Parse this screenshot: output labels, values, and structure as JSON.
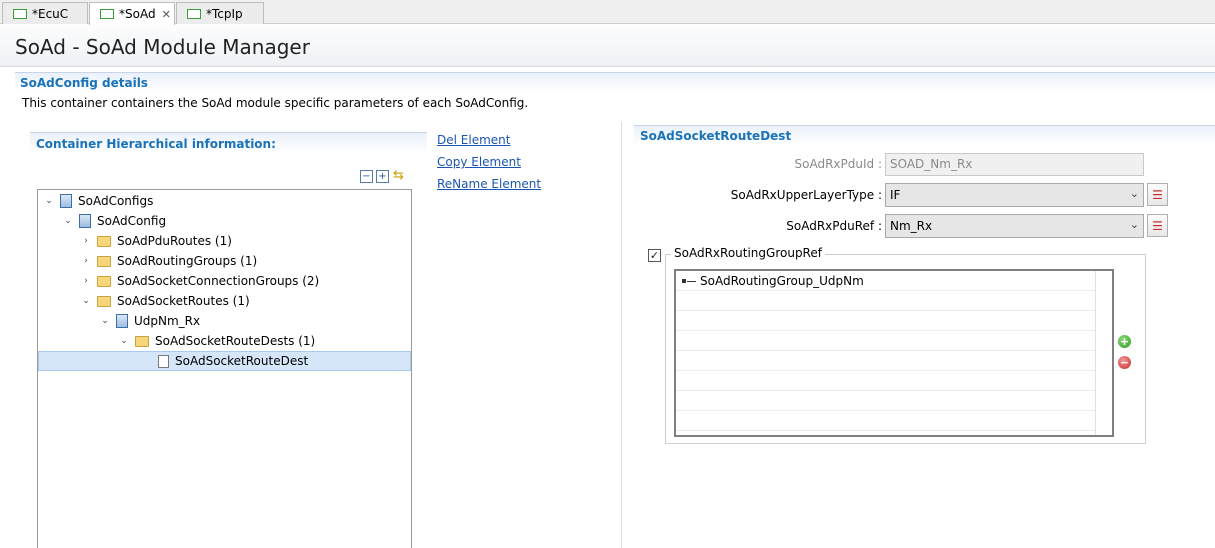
{
  "tabs": [
    {
      "label": "*EcuC"
    },
    {
      "label": "*SoAd",
      "close": "✕"
    },
    {
      "label": "*TcpIp"
    }
  ],
  "page_title": "SoAd - SoAd Module Manager",
  "section": {
    "title": "SoAdConfig details",
    "description": "This container containers the SoAd module specific parameters of each SoAdConfig."
  },
  "hierarchy": {
    "title": "Container Hierarchical information:",
    "tools": {
      "collapse": "−",
      "expand": "+",
      "sync": "⇆"
    },
    "nodes": [
      {
        "label": "SoAdConfigs",
        "twisty": "⌄"
      },
      {
        "label": "SoAdConfig",
        "twisty": "⌄"
      },
      {
        "label": "SoAdPduRoutes (1)",
        "twisty": "›"
      },
      {
        "label": "SoAdRoutingGroups (1)",
        "twisty": "›"
      },
      {
        "label": "SoAdSocketConnectionGroups (2)",
        "twisty": "›"
      },
      {
        "label": "SoAdSocketRoutes (1)",
        "twisty": "⌄"
      },
      {
        "label": "UdpNm_Rx",
        "twisty": "⌄"
      },
      {
        "label": "SoAdSocketRouteDests (1)",
        "twisty": "⌄"
      },
      {
        "label": "SoAdSocketRouteDest",
        "twisty": ""
      }
    ]
  },
  "actions": {
    "delete": "Del Element",
    "copy": "Copy Element",
    "rename": "ReName Element"
  },
  "details": {
    "title": "SoAdSocketRouteDest",
    "fields": {
      "rx_pdu_id": {
        "label": "SoAdRxPduId :",
        "value": "SOAD_Nm_Rx"
      },
      "upper_layer_type": {
        "label": "SoAdRxUpperLayerType :",
        "value": "IF",
        "caret": "⌄"
      },
      "pdu_ref": {
        "label": "SoAdRxPduRef :",
        "value": "Nm_Rx",
        "caret": "⌄"
      }
    },
    "list_button_icon": "☰",
    "routing_group_ref": {
      "checkbox": "✓",
      "title": "SoAdRxRoutingGroupRef",
      "items": [
        "SoAdRoutingGroup_UdpNm"
      ],
      "add_icon": "+",
      "remove_icon": "−"
    }
  },
  "colors": {
    "accent": "#1a73b8",
    "link": "#1c55b0",
    "selection": "#d4e6f8"
  }
}
